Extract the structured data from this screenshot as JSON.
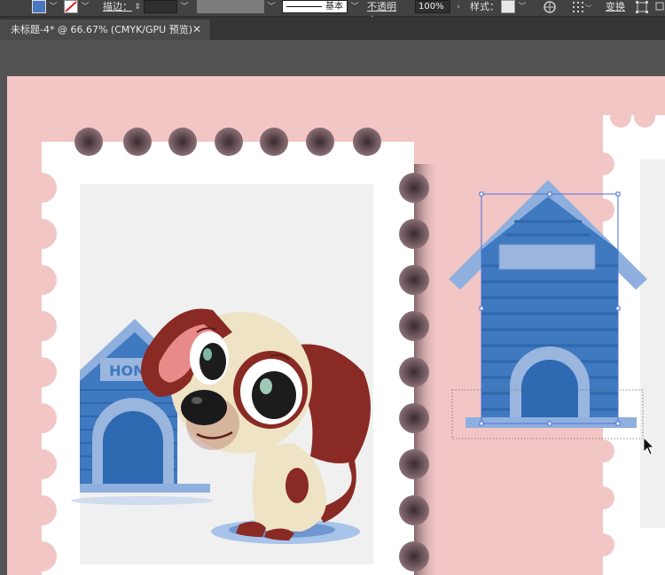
{
  "toolbar": {
    "stroke_label": "描边：",
    "stroke_weight_value": "",
    "stroke_profile_label": "基本",
    "opacity_label": "不透明度：",
    "opacity_value": "100%",
    "style_label": "样式：",
    "transform_label": "变换"
  },
  "tab": {
    "title": "未标题-4* @ 66.67% (CMYK/GPU 预览)",
    "close": "✕"
  },
  "artwork": {
    "house_sign_text": "HOME"
  },
  "colors": {
    "pink_bg": "#f3c6c6",
    "house_blue": "#3f79bf",
    "roof_light": "#8fb0de",
    "selection": "#4f6fd8"
  }
}
